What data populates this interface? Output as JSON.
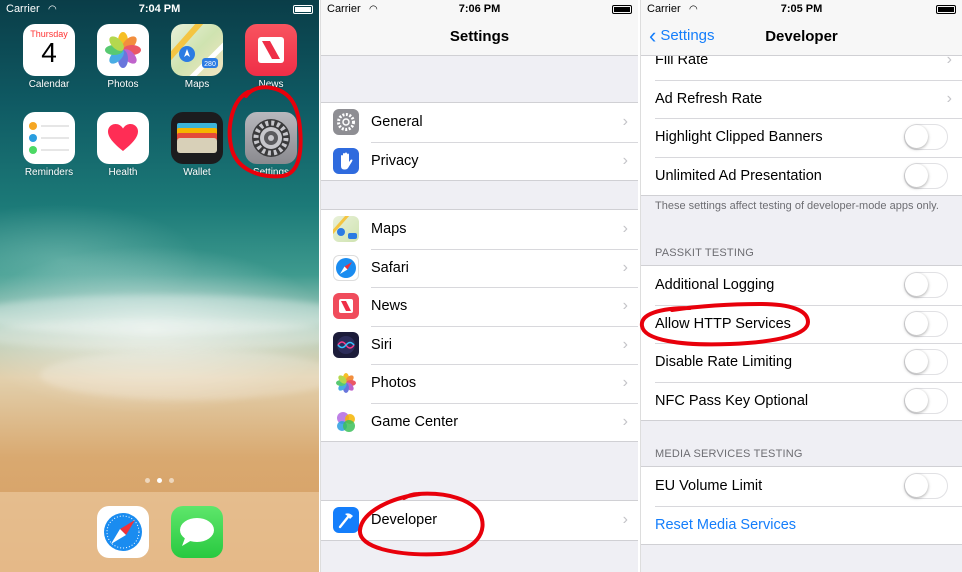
{
  "home": {
    "status": {
      "carrier": "Carrier",
      "time": "7:04 PM"
    },
    "calendar": {
      "weekday": "Thursday",
      "day": "4"
    },
    "apps": [
      {
        "label": "Calendar",
        "icon": "calendar-icon"
      },
      {
        "label": "Photos",
        "icon": "photos-icon"
      },
      {
        "label": "Maps",
        "icon": "maps-icon"
      },
      {
        "label": "News",
        "icon": "news-icon"
      },
      {
        "label": "Reminders",
        "icon": "reminders-icon"
      },
      {
        "label": "Health",
        "icon": "health-icon"
      },
      {
        "label": "Wallet",
        "icon": "wallet-icon"
      },
      {
        "label": "Settings",
        "icon": "settings-gear-icon"
      }
    ],
    "maps_badge": "280",
    "dock": [
      {
        "icon": "safari-icon"
      },
      {
        "icon": "messages-icon"
      }
    ]
  },
  "settings": {
    "status": {
      "carrier": "Carrier",
      "time": "7:06 PM"
    },
    "title": "Settings",
    "group1": [
      {
        "label": "General",
        "icon": "gear-icon",
        "color": "#8e8e93"
      },
      {
        "label": "Privacy",
        "icon": "hand-icon",
        "color": "#2f6bde"
      }
    ],
    "group2": [
      {
        "label": "Maps",
        "icon": "maps-icon"
      },
      {
        "label": "Safari",
        "icon": "compass-icon",
        "color": "#1a8cf0"
      },
      {
        "label": "News",
        "icon": "news-icon",
        "color": "#f04c5c"
      },
      {
        "label": "Siri",
        "icon": "siri-icon",
        "color": "#1c1c3a"
      },
      {
        "label": "Photos",
        "icon": "photos-icon"
      },
      {
        "label": "Game Center",
        "icon": "game-center-icon"
      }
    ],
    "group3": [
      {
        "label": "Developer",
        "icon": "hammer-icon",
        "color": "#147efb"
      }
    ]
  },
  "developer": {
    "status": {
      "carrier": "Carrier",
      "time": "7:05 PM"
    },
    "back_label": "Settings",
    "title": "Developer",
    "ads_rows": [
      {
        "label": "Fill Rate",
        "control": "chevron"
      },
      {
        "label": "Ad Refresh Rate",
        "control": "chevron"
      },
      {
        "label": "Highlight Clipped Banners",
        "control": "toggle"
      },
      {
        "label": "Unlimited Ad Presentation",
        "control": "toggle"
      }
    ],
    "ads_note": "These settings affect testing of developer-mode apps only.",
    "passkit_header": "PASSKIT TESTING",
    "passkit_rows": [
      {
        "label": "Additional Logging"
      },
      {
        "label": "Allow HTTP Services"
      },
      {
        "label": "Disable Rate Limiting"
      },
      {
        "label": "NFC Pass Key Optional"
      }
    ],
    "media_header": "MEDIA SERVICES TESTING",
    "media_rows": [
      {
        "label": "EU Volume Limit",
        "control": "toggle"
      },
      {
        "label": "Reset Media Services",
        "control": "link"
      }
    ]
  },
  "colors": {
    "accent": "#147efb",
    "annotation": "#e8000b"
  }
}
